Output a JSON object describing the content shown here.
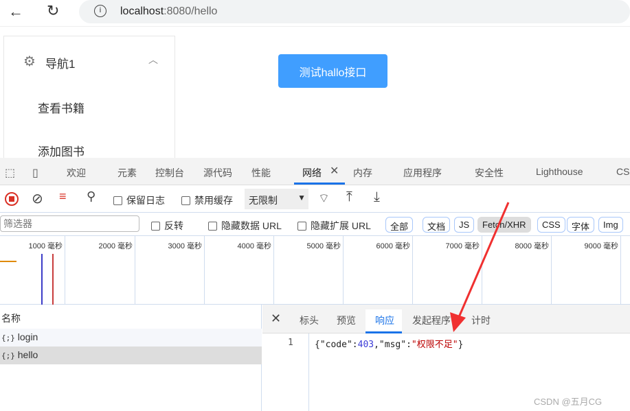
{
  "browser": {
    "url_host": "localhost",
    "url_rest": ":8080/hello"
  },
  "sidebar": {
    "group": "导航1",
    "items": [
      "查看书籍",
      "添加图书"
    ]
  },
  "main": {
    "button": "测试hallo接口"
  },
  "devtools": {
    "tabs": [
      "欢迎",
      "元素",
      "控制台",
      "源代码",
      "性能",
      "网络",
      "内存",
      "应用程序",
      "安全性",
      "Lighthouse",
      "CSS"
    ],
    "active_tab": "网络",
    "toolbar": {
      "preserve_log": "保留日志",
      "disable_cache": "禁用缓存",
      "throttle": "无限制"
    },
    "filter": {
      "placeholder": "筛选器",
      "invert": "反转",
      "hide_data": "隐藏数据 URL",
      "hide_ext": "隐藏扩展 URL",
      "types": [
        "全部",
        "文档",
        "JS",
        "Fetch/XHR",
        "CSS",
        "字体",
        "Img"
      ],
      "active_type": "Fetch/XHR"
    },
    "timeline": [
      "1000 毫秒",
      "2000 毫秒",
      "3000 毫秒",
      "4000 毫秒",
      "5000 毫秒",
      "6000 毫秒",
      "7000 毫秒",
      "8000 毫秒",
      "9000 毫秒"
    ],
    "requests": {
      "header": "名称",
      "items": [
        "login",
        "hello"
      ],
      "selected": "hello"
    },
    "detail_tabs": [
      "标头",
      "预览",
      "响应",
      "发起程序",
      "计时"
    ],
    "active_detail": "响应",
    "response": {
      "line": "1",
      "p1": "{\"code\":",
      "num": "403",
      "p2": ",\"msg\":",
      "str": "\"权限不足\"",
      "p3": "}"
    }
  },
  "watermark": "CSDN @五月CG",
  "colors": {
    "accent": "#409eff",
    "devtools_blue": "#1a73e8",
    "arrow": "#f03030"
  }
}
